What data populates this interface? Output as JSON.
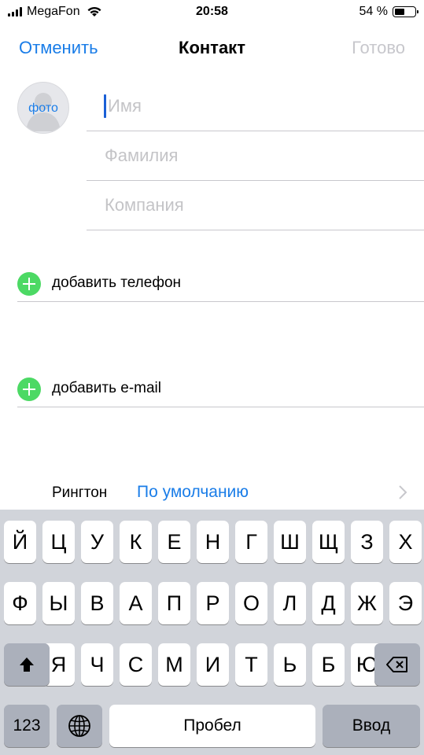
{
  "status_bar": {
    "carrier": "MegaFon",
    "time": "20:58",
    "battery": "54 %",
    "battery_level": 0.54
  },
  "nav": {
    "cancel": "Отменить",
    "title": "Контакт",
    "done": "Готово"
  },
  "photo": {
    "label": "фото"
  },
  "fields": {
    "first_name": "Имя",
    "last_name": "Фамилия",
    "company": "Компания"
  },
  "actions": {
    "add_phone": "добавить телефон",
    "add_email": "добавить e-mail"
  },
  "ringtone": {
    "label": "Рингтон",
    "value": "По умолчанию"
  },
  "keyboard": {
    "row1": [
      "Й",
      "Ц",
      "У",
      "К",
      "Е",
      "Н",
      "Г",
      "Ш",
      "Щ",
      "З",
      "Х"
    ],
    "row2": [
      "Ф",
      "Ы",
      "В",
      "А",
      "П",
      "Р",
      "О",
      "Л",
      "Д",
      "Ж",
      "Э"
    ],
    "row3": [
      "Я",
      "Ч",
      "С",
      "М",
      "И",
      "Т",
      "Ь",
      "Б",
      "Ю"
    ],
    "numbers": "123",
    "space": "Пробел",
    "return": "Ввод"
  }
}
